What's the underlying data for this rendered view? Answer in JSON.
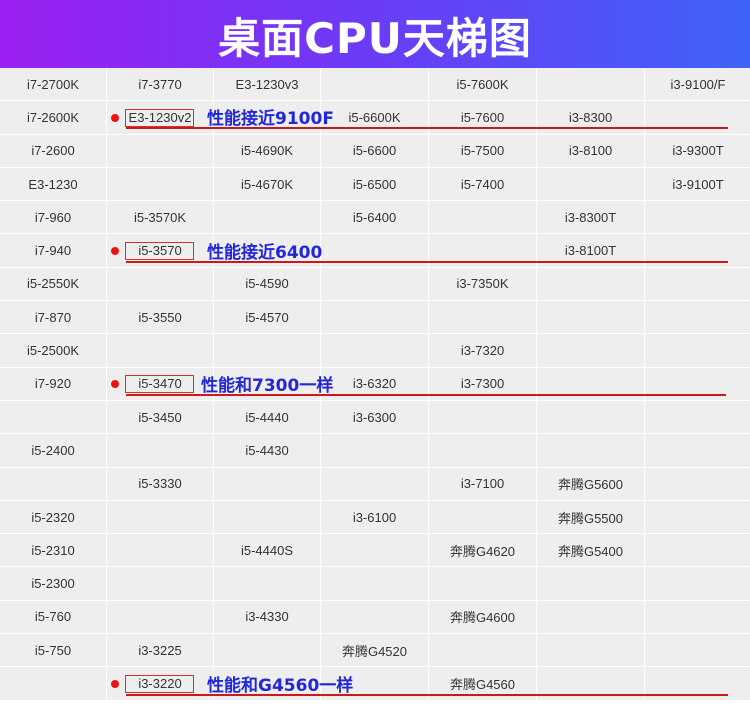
{
  "title": "桌面CPU天梯图",
  "rows": [
    [
      "i7-2700K",
      "i7-3770",
      "E3-1230v3",
      "",
      "i5-7600K",
      "",
      "i3-9100/F"
    ],
    [
      "i7-2600K",
      "E3-1230v2",
      "",
      "i5-6600K",
      "i5-7600",
      "i3-8300",
      ""
    ],
    [
      "i7-2600",
      "",
      "i5-4690K",
      "i5-6600",
      "i5-7500",
      "i3-8100",
      "i3-9300T"
    ],
    [
      "E3-1230",
      "",
      "i5-4670K",
      "i5-6500",
      "i5-7400",
      "",
      "i3-9100T"
    ],
    [
      "i7-960",
      "i5-3570K",
      "",
      "i5-6400",
      "",
      "i3-8300T",
      ""
    ],
    [
      "i7-940",
      "i5-3570",
      "",
      "",
      "",
      "i3-8100T",
      ""
    ],
    [
      "i5-2550K",
      "",
      "i5-4590",
      "",
      "i3-7350K",
      "",
      ""
    ],
    [
      "i7-870",
      "i5-3550",
      "i5-4570",
      "",
      "",
      "",
      ""
    ],
    [
      "i5-2500K",
      "",
      "",
      "",
      "i3-7320",
      "",
      ""
    ],
    [
      "i7-920",
      "i5-3470",
      "",
      "i3-6320",
      "i3-7300",
      "",
      ""
    ],
    [
      "",
      "i5-3450",
      "i5-4440",
      "i3-6300",
      "",
      "",
      ""
    ],
    [
      "i5-2400",
      "",
      "i5-4430",
      "",
      "",
      "",
      ""
    ],
    [
      "",
      "i5-3330",
      "",
      "",
      "i3-7100",
      "奔腾G5600",
      ""
    ],
    [
      "i5-2320",
      "",
      "",
      "i3-6100",
      "",
      "奔腾G5500",
      ""
    ],
    [
      "i5-2310",
      "",
      "i5-4440S",
      "",
      "奔腾G4620",
      "奔腾G5400",
      ""
    ],
    [
      "i5-2300",
      "",
      "",
      "",
      "",
      "",
      ""
    ],
    [
      "i5-760",
      "",
      "i3-4330",
      "",
      "奔腾G4600",
      "",
      ""
    ],
    [
      "i5-750",
      "i3-3225",
      "",
      "奔腾G4520",
      "",
      "",
      ""
    ],
    [
      "",
      "i3-3220",
      "",
      "",
      "奔腾G4560",
      "",
      ""
    ]
  ],
  "annotations": [
    {
      "text": "性能接近9100F"
    },
    {
      "text": "性能接近6400"
    },
    {
      "text": "性能和7300一样"
    },
    {
      "text": "性能和G4560一样"
    }
  ],
  "colors": {
    "banner_start": "#9b1ff0",
    "banner_end": "#3f63f7",
    "cell_bg": "#eeeeee",
    "note_text": "#2327d6",
    "marker_red": "#cc1a1a"
  }
}
